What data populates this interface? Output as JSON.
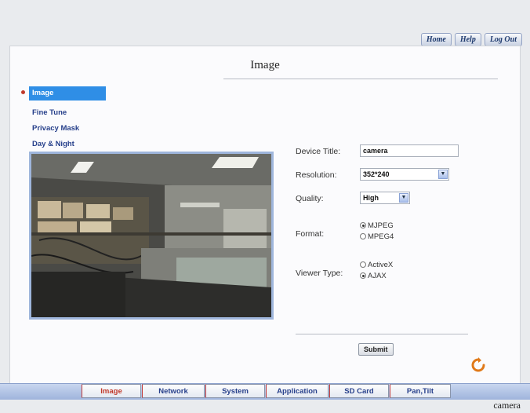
{
  "topnav": {
    "home": "Home",
    "help": "Help",
    "logout": "Log Out"
  },
  "page": {
    "title": "Image"
  },
  "menu": {
    "items": [
      {
        "label": "Image",
        "active": true
      },
      {
        "label": "Fine Tune"
      },
      {
        "label": "Privacy Mask"
      },
      {
        "label": "Day & Night"
      }
    ]
  },
  "form": {
    "device_title": {
      "label": "Device Title:",
      "value": "camera"
    },
    "resolution": {
      "label": "Resolution:",
      "value": "352*240"
    },
    "quality": {
      "label": "Quality:",
      "value": "High"
    },
    "format": {
      "label": "Format:",
      "options": [
        "MJPEG",
        "MPEG4"
      ],
      "selected": "MJPEG"
    },
    "viewer_type": {
      "label": "Viewer Type:",
      "options": [
        "ActiveX",
        "AJAX"
      ],
      "selected": "AJAX"
    },
    "submit": "Submit"
  },
  "tabs": [
    "Image",
    "Network",
    "System",
    "Application",
    "SD Card",
    "Pan,Tilt"
  ],
  "footer": {
    "brand": "camera"
  },
  "colors": {
    "accent": "#2f8ee6",
    "link": "#27408b",
    "active_tab": "#c0392b"
  }
}
